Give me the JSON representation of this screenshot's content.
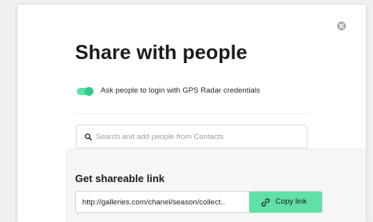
{
  "modal": {
    "title": "Share with people"
  },
  "login_toggle": {
    "label": "Ask people to login with GPS Radar credentials",
    "enabled": true,
    "accent_color": "#5ee0a6"
  },
  "search": {
    "placeholder": "Search and add people from Contacts",
    "value": ""
  },
  "shareable_link": {
    "title": "Get shareable link",
    "url": "http://galleries.com/chanel/season/collect..",
    "copy_label": "Copy link",
    "button_color": "#5ee0a6"
  },
  "icons": {
    "close": "close-icon",
    "search": "search-icon",
    "copy": "link-icon"
  }
}
